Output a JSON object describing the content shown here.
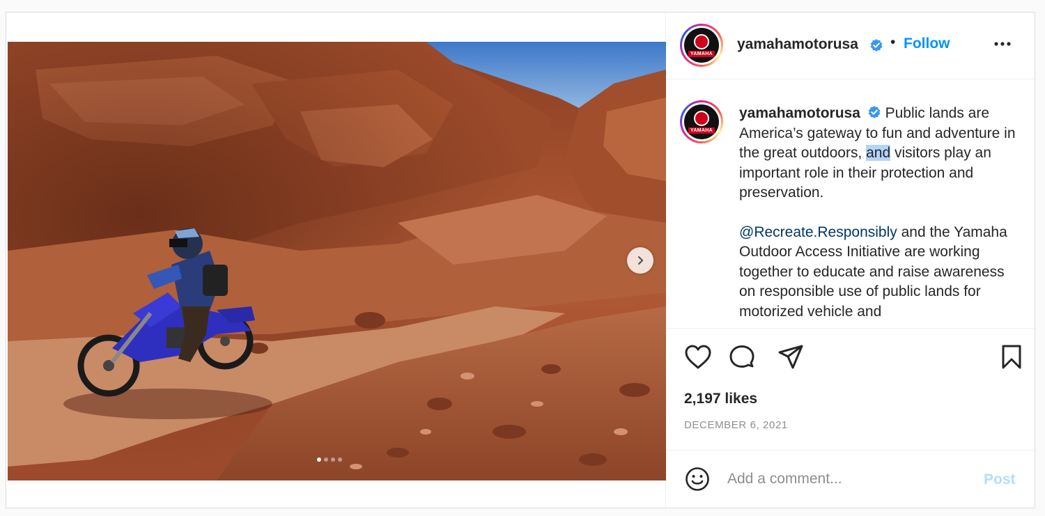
{
  "post": {
    "account": {
      "username": "yamahamotorusa",
      "verified": true,
      "avatar_logo_text": "YAMAHA"
    },
    "header": {
      "separator": "•",
      "follow_label": "Follow",
      "more_icon": "more-options-icon"
    },
    "caption": {
      "username": "yamahamotorusa",
      "text_part1": " Public lands are America’s gateway to fun and adventure in the great outdoors, ",
      "highlighted": "and",
      "text_part2": " visitors play an important role in their protection and preservation.",
      "mention": "@Recreate.Responsibly",
      "text_part3": " and the Yamaha Outdoor Access Initiative are working together to educate and raise awareness on responsible use of public lands for motorized vehicle and"
    },
    "media": {
      "carousel_total": 4,
      "carousel_current": 1,
      "next_icon": "chevron-right-icon"
    },
    "actions": {
      "like_icon": "heart-icon",
      "comment_icon": "comment-icon",
      "share_icon": "share-icon",
      "save_icon": "bookmark-icon"
    },
    "likes_text": "2,197 likes",
    "date_text": "DECEMBER 6, 2021",
    "comment": {
      "placeholder": "Add a comment...",
      "value": "",
      "post_label": "Post",
      "emoji_icon": "emoji-icon"
    },
    "colors": {
      "accent": "#0095f6",
      "post_disabled": "#b2dffc",
      "mention": "#00376b",
      "highlight": "#b3d4fc",
      "verified": "#3897f0"
    }
  }
}
